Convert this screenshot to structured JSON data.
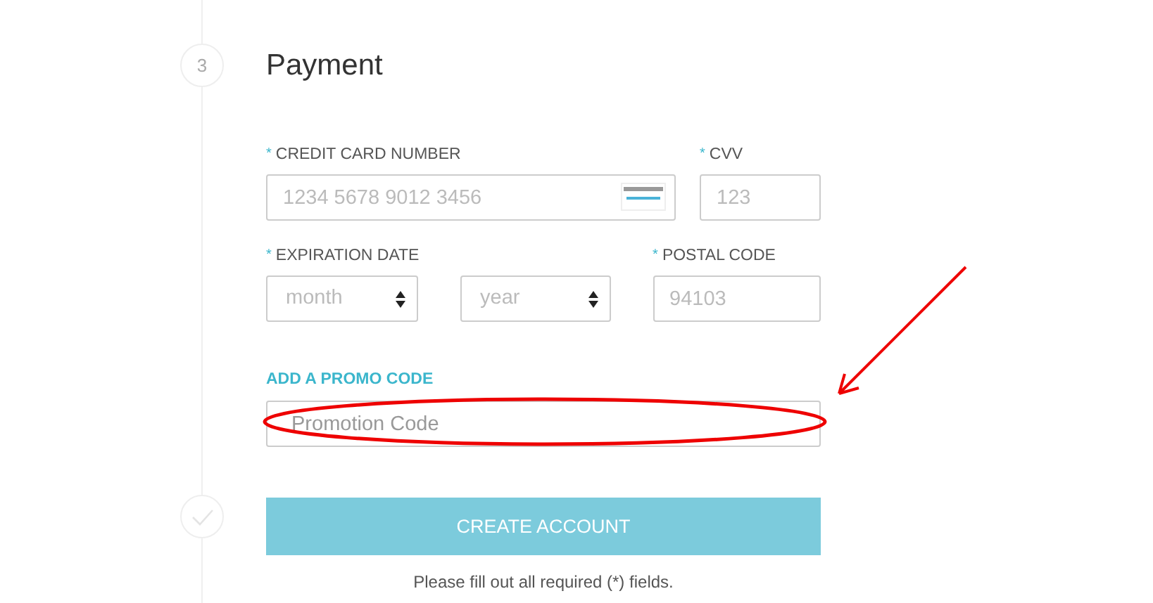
{
  "steps": [
    {
      "kind": "number",
      "text": "3"
    },
    {
      "kind": "done"
    }
  ],
  "title": "Payment",
  "rows": [
    {
      "fields": [
        {
          "kind": "card",
          "mark": "*",
          "label": "CREDIT CARD NUMBER",
          "placeholder": "1234 5678 9012 3456"
        },
        {
          "kind": "text",
          "mark": "*",
          "label": "CVV",
          "placeholder": "123"
        }
      ]
    },
    {
      "fields": [
        {
          "kind": "select",
          "mark": "*",
          "label": "EXPIRATION DATE",
          "placeholder": "month"
        },
        {
          "kind": "select",
          "placeholder": "year"
        },
        {
          "kind": "text",
          "mark": "*",
          "label": "POSTAL CODE",
          "placeholder": "94103"
        }
      ]
    }
  ],
  "promo": {
    "link": "ADD A PROMO CODE",
    "placeholder": "Promotion Code"
  },
  "submit": {
    "label": "CREATE ACCOUNT",
    "disabled": true
  },
  "hint": "Please fill out all required (*) fields."
}
